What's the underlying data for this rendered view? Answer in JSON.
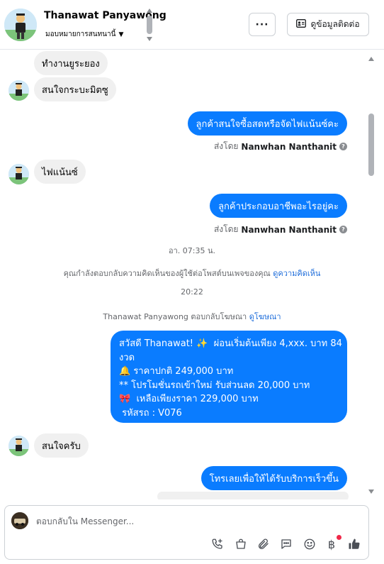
{
  "header": {
    "contact_name": "Thanawat Panyawong",
    "assign_label": "มอบหมายการสนทนานี้",
    "more_label": "···",
    "contact_info_label": "ดูข้อมูลติดต่อ"
  },
  "messages": {
    "m1": "ทำงานยูระยอง",
    "m2": "สนใจกระบะมิตซู",
    "m3": "ลูกค้าสนใจซื้อสดหรือจัดไฟแน้นซ์คะ",
    "m3_sent_by_prefix": "ส่งโดย",
    "m3_sender": "Nanwhan Nanthanit",
    "m4": "ไฟแน้นซ์",
    "m5": "ลูกค้าประกอบอาชีพอะไรอยู่คะ",
    "m5_sent_by_prefix": "ส่งโดย",
    "m5_sender": "Nanwhan Nanthanit",
    "time1": "อา. 07:35 น.",
    "sys1_text": "คุณกำลังตอบกลับความคิดเห็นของผู้ใช้ต่อโพสต์บนเพจของคุณ",
    "sys1_link": "ดูความคิดเห็น",
    "time2": "20:22",
    "sys2_text": "Thanawat Panyawong ตอบกลับโฆษณา",
    "sys2_link": "ดูโฆษณา",
    "promo_lines": [
      "สวัสดี Thanawat! ✨  ผ่อนเริ่มต้นเพียง 4,xxx. บาท 84",
      "งวด",
      "🔔 ราคาปกติ 249,000 บาท",
      "** โปรโมชั่นรถเข้าใหม่ รับส่วนลด 20,000 บาท",
      "🎀  เหลือเพียงราคา 229,000 บาท",
      " รหัสรถ : V076"
    ],
    "m6": "สนใจครับ",
    "m7": "โทรเลยเพื่อให้ได้รับบริการเร็วขึ้น"
  },
  "composer": {
    "placeholder": "ตอบกลับใน Messenger..."
  },
  "colors": {
    "outgoing": "#0a7cff",
    "incoming": "#f0f0f0",
    "link": "#216fdb",
    "notification": "#f02849"
  },
  "icons": {
    "toolbar": [
      "phone-plus-icon",
      "shopping-bag-icon",
      "paperclip-icon",
      "chat-bubble-icon",
      "emoji-icon",
      "baht-icon",
      "thumbs-up-icon"
    ]
  }
}
